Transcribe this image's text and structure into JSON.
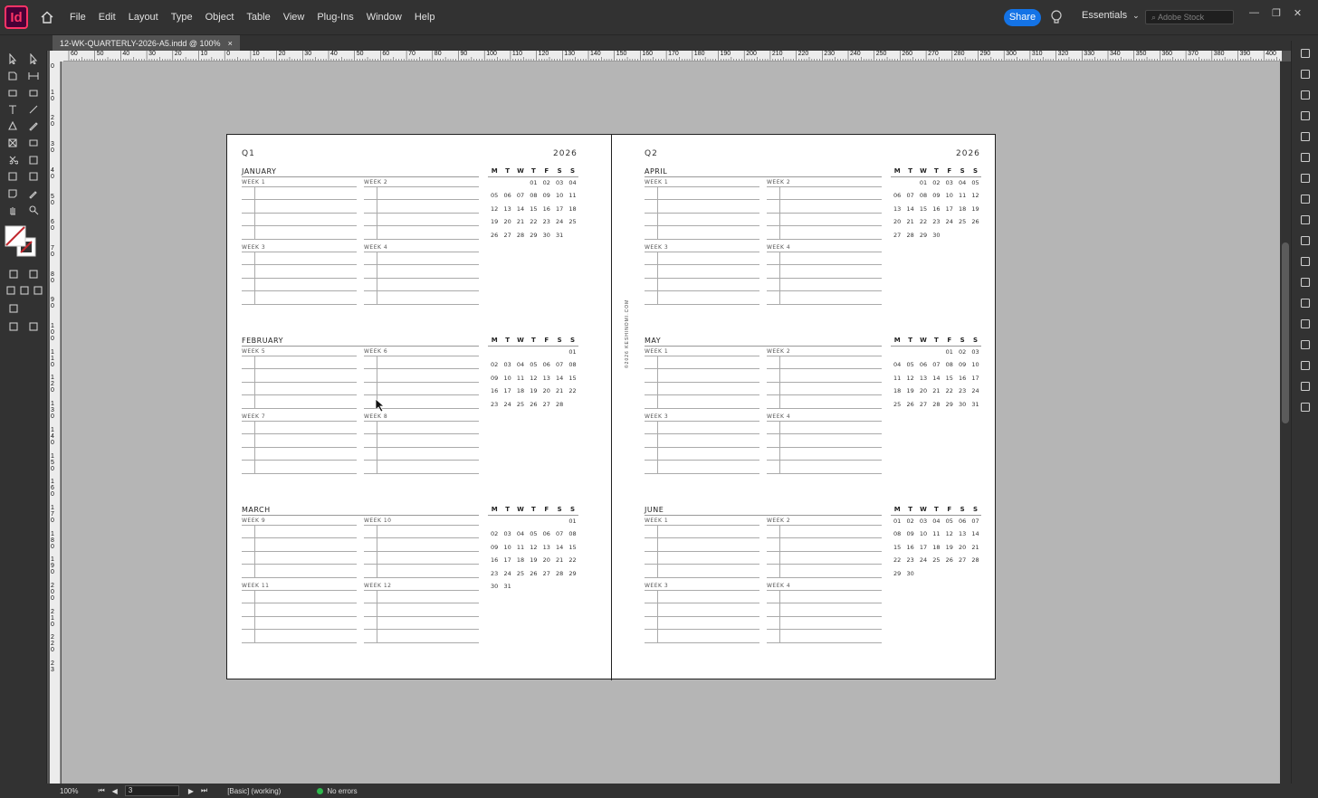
{
  "app": {
    "logo_text": "Id",
    "accent": "#ff3366",
    "logo_bg": "#470137"
  },
  "menubar": {
    "items": [
      "File",
      "Edit",
      "Layout",
      "Type",
      "Object",
      "Table",
      "View",
      "Plug-Ins",
      "Window",
      "Help"
    ],
    "share_label": "Share",
    "workspace_label": "Essentials",
    "stock_placeholder": "Adobe Stock",
    "minimize": "—",
    "restore": "❐",
    "close": "✕"
  },
  "document_tab": {
    "title": "12-WK-QUARTERLY-2026-A5.indd @ 100%",
    "close": "×"
  },
  "rulers": {
    "horizontal": [
      "60",
      "50",
      "40",
      "30",
      "20",
      "10",
      "0",
      "10",
      "20",
      "30",
      "40",
      "50",
      "60",
      "70",
      "80",
      "90",
      "100",
      "110",
      "120",
      "130",
      "140",
      "150",
      "160",
      "170",
      "180",
      "190",
      "200",
      "210",
      "220",
      "230",
      "240",
      "250",
      "260",
      "270",
      "280",
      "290",
      "300",
      "310",
      "320",
      "330",
      "340",
      "350",
      "360",
      "370",
      "380",
      "390",
      "400"
    ],
    "vertical": [
      "0",
      "1 0",
      "2 0",
      "3 0",
      "4 0",
      "5 0",
      "6 0",
      "7 0",
      "8 0",
      "9 0",
      "1 0 0",
      "1 1 0",
      "1 2 0",
      "1 3 0",
      "1 4 0",
      "1 5 0",
      "1 6 0",
      "1 7 0",
      "1 8 0",
      "1 9 0",
      "2 0 0",
      "2 1 0",
      "2 2 0",
      "2 3"
    ]
  },
  "status": {
    "zoom": "100%",
    "page": "3",
    "preflight_profile": "[Basic] (working)",
    "errors": "No errors",
    "error_color": "#2fb84d"
  },
  "spread": {
    "credit": "©2026 KESHINOMI.COM",
    "weekday_headers": [
      "M",
      "T",
      "W",
      "T",
      "F",
      "S",
      "S"
    ],
    "pages": [
      {
        "quarter": "Q1",
        "year": "2026",
        "months": [
          {
            "name": "JANUARY",
            "weeks": [
              "WEEK 1",
              "WEEK 2",
              "WEEK 3",
              "WEEK 4"
            ],
            "calendar": [
              [
                "",
                "",
                "",
                "01",
                "02",
                "03",
                "04"
              ],
              [
                "05",
                "06",
                "07",
                "08",
                "09",
                "10",
                "11"
              ],
              [
                "12",
                "13",
                "14",
                "15",
                "16",
                "17",
                "18"
              ],
              [
                "19",
                "20",
                "21",
                "22",
                "23",
                "24",
                "25"
              ],
              [
                "26",
                "27",
                "28",
                "29",
                "30",
                "31",
                ""
              ]
            ]
          },
          {
            "name": "FEBRUARY",
            "weeks": [
              "WEEK 5",
              "WEEK 6",
              "WEEK 7",
              "WEEK 8"
            ],
            "calendar": [
              [
                "",
                "",
                "",
                "",
                "",
                "",
                "01"
              ],
              [
                "02",
                "03",
                "04",
                "05",
                "06",
                "07",
                "08"
              ],
              [
                "09",
                "10",
                "11",
                "12",
                "13",
                "14",
                "15"
              ],
              [
                "16",
                "17",
                "18",
                "19",
                "20",
                "21",
                "22"
              ],
              [
                "23",
                "24",
                "25",
                "26",
                "27",
                "28",
                ""
              ]
            ]
          },
          {
            "name": "MARCH",
            "weeks": [
              "WEEK 9",
              "WEEK 10",
              "WEEK 11",
              "WEEK 12"
            ],
            "calendar": [
              [
                "",
                "",
                "",
                "",
                "",
                "",
                "01"
              ],
              [
                "02",
                "03",
                "04",
                "05",
                "06",
                "07",
                "08"
              ],
              [
                "09",
                "10",
                "11",
                "12",
                "13",
                "14",
                "15"
              ],
              [
                "16",
                "17",
                "18",
                "19",
                "20",
                "21",
                "22"
              ],
              [
                "23",
                "24",
                "25",
                "26",
                "27",
                "28",
                "29"
              ],
              [
                "30",
                "31",
                "",
                "",
                "",
                "",
                ""
              ]
            ]
          }
        ]
      },
      {
        "quarter": "Q2",
        "year": "2026",
        "months": [
          {
            "name": "APRIL",
            "weeks": [
              "WEEK 1",
              "WEEK 2",
              "WEEK 3",
              "WEEK 4"
            ],
            "calendar": [
              [
                "",
                "",
                "01",
                "02",
                "03",
                "04",
                "05"
              ],
              [
                "06",
                "07",
                "08",
                "09",
                "10",
                "11",
                "12"
              ],
              [
                "13",
                "14",
                "15",
                "16",
                "17",
                "18",
                "19"
              ],
              [
                "20",
                "21",
                "22",
                "23",
                "24",
                "25",
                "26"
              ],
              [
                "27",
                "28",
                "29",
                "30",
                "",
                "",
                ""
              ]
            ]
          },
          {
            "name": "MAY",
            "weeks": [
              "WEEK 1",
              "WEEK 2",
              "WEEK 3",
              "WEEK 4"
            ],
            "calendar": [
              [
                "",
                "",
                "",
                "",
                "01",
                "02",
                "03"
              ],
              [
                "04",
                "05",
                "06",
                "07",
                "08",
                "09",
                "10"
              ],
              [
                "11",
                "12",
                "13",
                "14",
                "15",
                "16",
                "17"
              ],
              [
                "18",
                "19",
                "20",
                "21",
                "22",
                "23",
                "24"
              ],
              [
                "25",
                "26",
                "27",
                "28",
                "29",
                "30",
                "31"
              ]
            ]
          },
          {
            "name": "JUNE",
            "weeks": [
              "WEEK 1",
              "WEEK 2",
              "WEEK 3",
              "WEEK 4"
            ],
            "calendar": [
              [
                "01",
                "02",
                "03",
                "04",
                "05",
                "06",
                "07"
              ],
              [
                "08",
                "09",
                "10",
                "11",
                "12",
                "13",
                "14"
              ],
              [
                "15",
                "16",
                "17",
                "18",
                "19",
                "20",
                "21"
              ],
              [
                "22",
                "23",
                "24",
                "25",
                "26",
                "27",
                "28"
              ],
              [
                "29",
                "30",
                "",
                "",
                "",
                "",
                ""
              ]
            ]
          }
        ]
      }
    ]
  }
}
